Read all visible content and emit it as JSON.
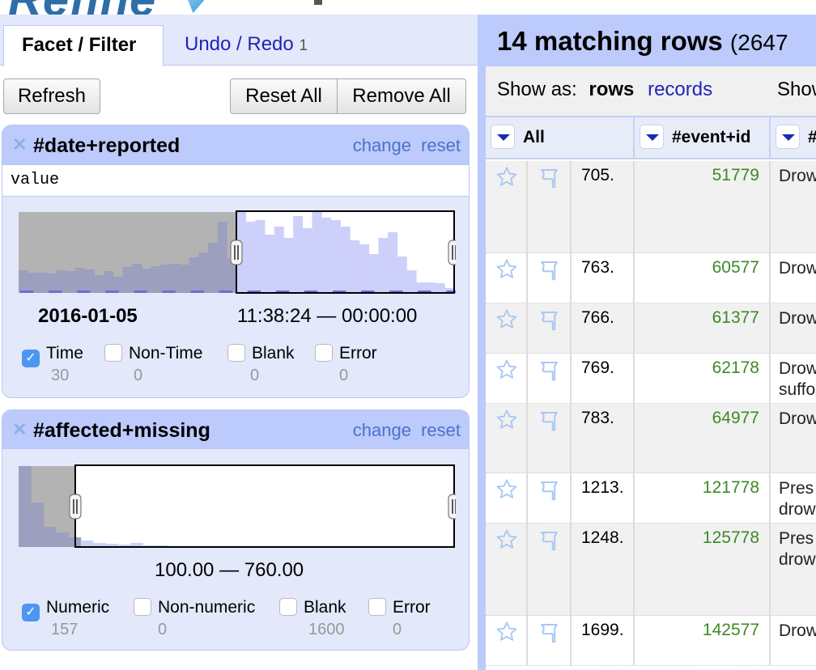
{
  "app": {
    "logo_text": "Refine"
  },
  "left_panel": {
    "tabs": [
      {
        "label": "Facet / Filter",
        "active": true
      },
      {
        "label": "Undo / Redo",
        "count": "1",
        "active": false
      }
    ],
    "buttons": {
      "refresh": "Refresh",
      "reset_all": "Reset All",
      "remove_all": "Remove All"
    },
    "facets": [
      {
        "title": "#date+reported",
        "links": {
          "change": "change",
          "reset": "reset"
        },
        "expression": "value",
        "range_from": "2016-01-05",
        "range_to": "11:38:24 — 00:00:00",
        "selection": {
          "from_fraction": 0.5,
          "to_fraction": 1.0
        },
        "histogram": {
          "all": [
            0.28,
            0.25,
            0.25,
            0.24,
            0.28,
            0.27,
            0.31,
            0.29,
            0.22,
            0.27,
            0.2,
            0.32,
            0.36,
            0.3,
            0.33,
            0.35,
            0.36,
            0.35,
            0.44,
            0.5,
            0.62,
            0.88,
            0.42,
            1.0,
            0.88,
            0.9,
            0.72,
            0.82,
            0.68,
            0.95,
            0.8,
            1.0,
            0.93,
            0.9,
            0.82,
            0.65,
            0.6,
            0.48,
            0.68,
            0.75,
            0.45,
            0.28,
            0.13,
            0.13,
            0.12,
            0.06
          ],
          "selected": [
            0,
            0,
            0,
            0,
            0,
            0,
            0,
            0,
            0,
            0,
            0,
            0,
            0,
            0,
            0,
            0,
            0,
            0,
            0,
            0,
            0,
            0,
            0,
            0.78,
            0.8,
            0.9,
            0.72,
            0.82,
            0.68,
            0.95,
            0.8,
            1.0,
            0.93,
            0.9,
            0.82,
            0.65,
            0.6,
            0.48,
            0.68,
            0.75,
            0.45,
            0.28,
            0.13,
            0.13,
            0.12,
            0.06
          ]
        },
        "choices": [
          {
            "label": "Time",
            "count": "30",
            "checked": true
          },
          {
            "label": "Non-Time",
            "count": "0",
            "checked": false
          },
          {
            "label": "Blank",
            "count": "0",
            "checked": false
          },
          {
            "label": "Error",
            "count": "0",
            "checked": false
          }
        ]
      },
      {
        "title": "#affected+missing",
        "links": {
          "change": "change",
          "reset": "reset"
        },
        "range": "100.00 — 760.00",
        "selection": {
          "from_fraction": 0.13,
          "to_fraction": 1.0
        },
        "histogram": {
          "all": [
            1.0,
            0.55,
            0.25,
            0.18,
            0.12,
            0.08,
            0.05,
            0.04,
            0.03,
            0.05,
            0.02,
            0.02,
            0.01,
            0.01,
            0.01,
            0.01,
            0.0,
            0.01,
            0.0,
            0.01,
            0.0,
            0.0,
            0.01,
            0.0,
            0.0,
            0.0,
            0.0,
            0.0,
            0.01,
            0.0,
            0.0,
            0.0,
            0.0,
            0.0,
            0.01
          ]
        },
        "choices": [
          {
            "label": "Numeric",
            "count": "157",
            "checked": true
          },
          {
            "label": "Non-numeric",
            "count": "0",
            "checked": false
          },
          {
            "label": "Blank",
            "count": "1600",
            "checked": false
          },
          {
            "label": "Error",
            "count": "0",
            "checked": false
          }
        ]
      }
    ]
  },
  "right_panel": {
    "summary_count": "14 matching rows",
    "summary_total": "(2647",
    "show_as_label": "Show as:",
    "show_as_current": "rows",
    "show_as_alt": "records",
    "show_label_2": "Show",
    "columns": [
      {
        "label": "All"
      },
      {
        "label": "#event+id"
      },
      {
        "label": "#"
      }
    ],
    "rows": [
      {
        "num": "705.",
        "event_id": "51779",
        "text": "Drow",
        "lines": 3
      },
      {
        "num": "763.",
        "event_id": "60577",
        "text": "Drow",
        "lines": 1
      },
      {
        "num": "766.",
        "event_id": "61377",
        "text": "Drow",
        "lines": 1
      },
      {
        "num": "769.",
        "event_id": "62178",
        "text": "Drow\nsuffo",
        "lines": 1
      },
      {
        "num": "783.",
        "event_id": "64977",
        "text": "Drow",
        "lines": 2
      },
      {
        "num": "1213.",
        "event_id": "121778",
        "text": "Pres\ndrow",
        "lines": 1
      },
      {
        "num": "1248.",
        "event_id": "125778",
        "text": "Pres\ndrow",
        "lines": 3
      },
      {
        "num": "1699.",
        "event_id": "142577",
        "text": "Drow",
        "lines": 1
      }
    ]
  }
}
